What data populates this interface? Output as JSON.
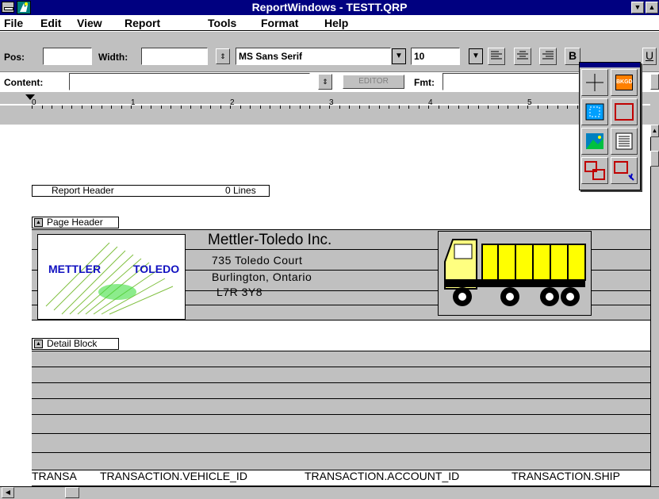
{
  "window": {
    "title": "ReportWindows - TESTT.QRP"
  },
  "menu": [
    {
      "label": "File"
    },
    {
      "label": "Edit"
    },
    {
      "label": "View"
    },
    {
      "label": "Report"
    },
    {
      "label": "Tools"
    },
    {
      "label": "Format"
    },
    {
      "label": "Help"
    }
  ],
  "toolbar": {
    "pos_label": "Pos:",
    "pos_value": "",
    "width_label": "Width:",
    "width_value": "",
    "font_name": "MS Sans Serif",
    "font_size": "10",
    "content_label": "Content:",
    "content_value": "",
    "editor_label": "EDITOR",
    "fmt_label": "Fmt:",
    "fmt_value": "",
    "bold_label": "B",
    "underline_label": "U"
  },
  "ruler": {
    "marks": [
      "0",
      "1",
      "2",
      "3",
      "4",
      "5"
    ]
  },
  "report": {
    "report_header": {
      "label": "Report Header",
      "lines": "0 Lines"
    },
    "page_header": {
      "label": "Page Header",
      "logo_left": "METTLER",
      "logo_right": "TOLEDO",
      "company": "Mettler-Toledo Inc.",
      "address1": "735 Toledo Court",
      "address2": "Burlington, Ontario",
      "postal": "L7R 3Y8"
    },
    "detail_block": {
      "label": "Detail Block"
    },
    "fields": [
      "TRANSA",
      "TRANSACTION.VEHICLE_ID",
      "TRANSACTION.ACCOUNT_ID",
      "TRANSACTION.SHIP"
    ]
  },
  "palette": {
    "tools": [
      {
        "name": "crosshair-tool"
      },
      {
        "name": "background-tool",
        "label": "BKGD"
      },
      {
        "name": "field-tool"
      },
      {
        "name": "box-tool"
      },
      {
        "name": "picture-tool"
      },
      {
        "name": "text-block-tool"
      },
      {
        "name": "link-tool"
      },
      {
        "name": "sub-report-tool"
      }
    ]
  },
  "colors": {
    "titlebar": "#000080",
    "face": "#c0c0c0",
    "logo_text": "#1010c0",
    "truck": "#ffff00"
  }
}
